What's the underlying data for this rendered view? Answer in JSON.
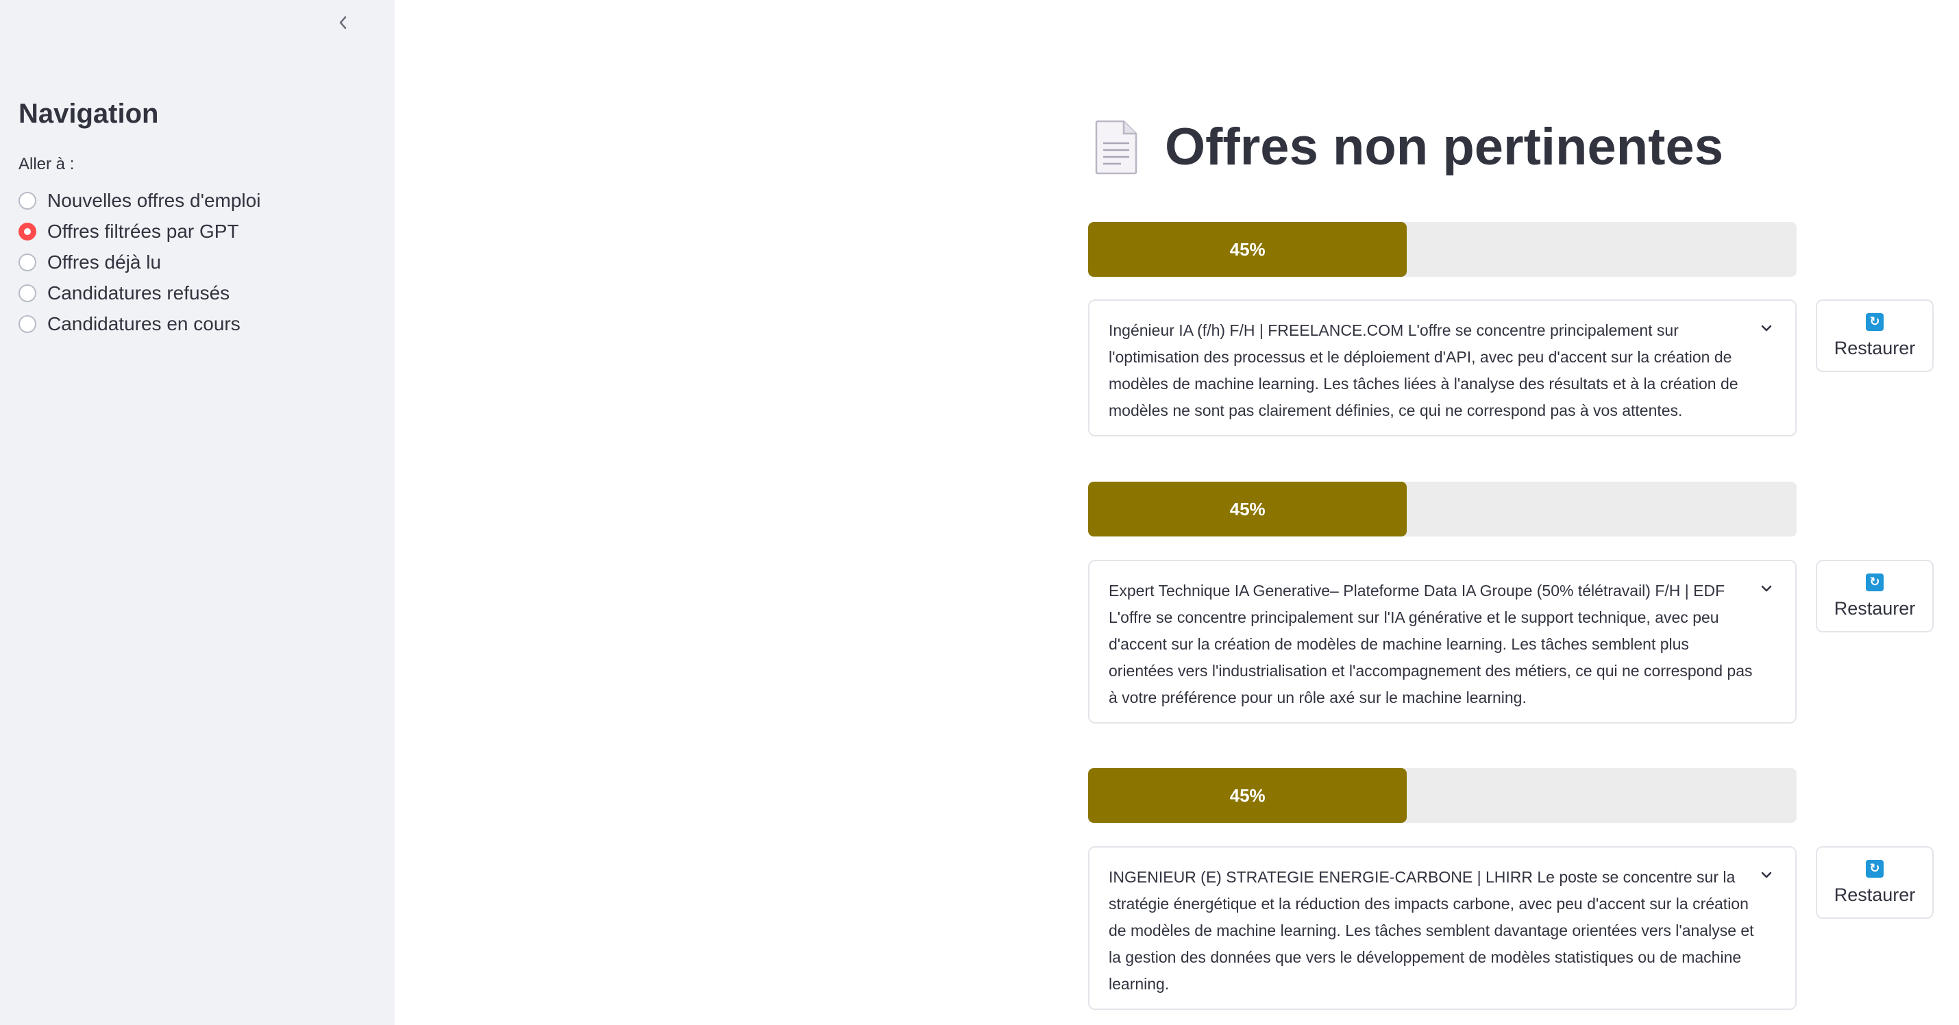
{
  "sidebar": {
    "collapse_icon": "chevron-left-icon",
    "title": "Navigation",
    "radio_label": "Aller à :",
    "options": [
      {
        "label": "Nouvelles offres d'emploi",
        "selected": false
      },
      {
        "label": "Offres filtrées par GPT",
        "selected": true
      },
      {
        "label": "Offres déjà lu",
        "selected": false
      },
      {
        "label": "Candidatures refusés",
        "selected": false
      },
      {
        "label": "Candidatures en cours",
        "selected": false
      }
    ]
  },
  "main": {
    "page_icon": "document-icon",
    "title": "Offres non pertinentes",
    "offers": [
      {
        "score_label": "45%",
        "score": 0.45,
        "description": "Ingénieur IA (f/h) F/H | FREELANCE.COM L'offre se concentre principalement sur l'optimisation des processus et le déploiement d'API, avec peu d'accent sur la création de modèles de machine learning. Les tâches liées à l'analyse des résultats et à la création de modèles ne sont pas clairement définies, ce qui ne correspond pas à vos attentes.",
        "restore_label": "Restaurer"
      },
      {
        "score_label": "45%",
        "score": 0.45,
        "description": "Expert Technique IA Generative– Plateforme Data IA Groupe (50% télétravail) F/H | EDF L'offre se concentre principalement sur l'IA générative et le support technique, avec peu d'accent sur la création de modèles de machine learning. Les tâches semblent plus orientées vers l'industrialisation et l'accompagnement des métiers, ce qui ne correspond pas à votre préférence pour un rôle axé sur le machine learning.",
        "restore_label": "Restaurer"
      },
      {
        "score_label": "45%",
        "score": 0.45,
        "description": "INGENIEUR (E) STRATEGIE ENERGIE-CARBONE | LHIRR Le poste se concentre sur la stratégie énergétique et la réduction des impacts carbone, avec peu d'accent sur la création de modèles de machine learning. Les tâches semblent davantage orientées vers l'analyse et la gestion des données que vers le développement de modèles statistiques ou de machine learning.",
        "restore_label": "Restaurer"
      }
    ]
  },
  "colors": {
    "sidebar_bg": "#f0f2f6",
    "progress_fill": "#8b7500",
    "progress_track": "#ececec",
    "radio_selected": "#ff4b4b",
    "restore_icon": "#1e96d8"
  }
}
